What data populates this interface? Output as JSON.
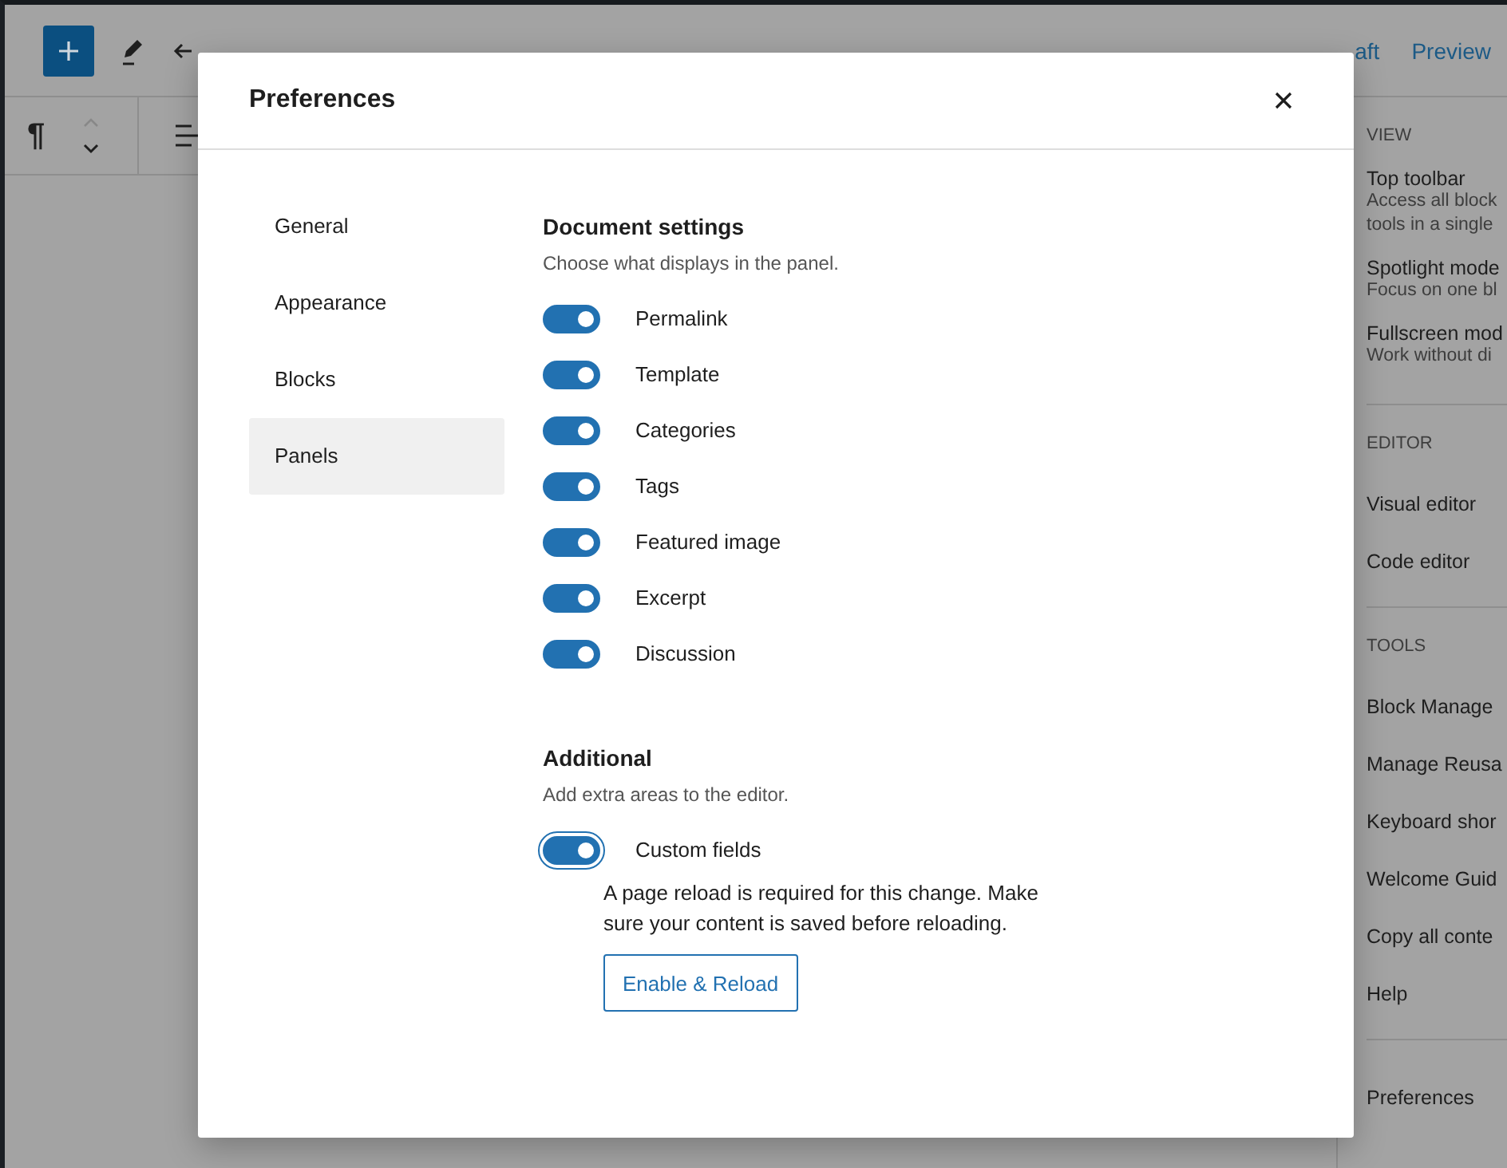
{
  "top_bar": {
    "save_draft": "aft",
    "preview": "Preview"
  },
  "block_toolbar": {
    "paragraph": "¶"
  },
  "sidebar": {
    "sections": [
      {
        "heading": "VIEW",
        "items": [
          {
            "label": "Top toolbar",
            "description": [
              "Access all block",
              "tools in a single"
            ]
          },
          {
            "label": "Spotlight mode",
            "description": [
              "Focus on one bl"
            ]
          },
          {
            "label": "Fullscreen mod",
            "description": [
              "Work without di"
            ]
          }
        ]
      },
      {
        "heading": "EDITOR",
        "items": [
          {
            "label": "Visual editor"
          },
          {
            "label": "Code editor"
          }
        ]
      },
      {
        "heading": "TOOLS",
        "items": [
          {
            "label": "Block Manage"
          },
          {
            "label": "Manage Reusa"
          },
          {
            "label": "Keyboard shor"
          },
          {
            "label": "Welcome Guid"
          },
          {
            "label": "Copy all conte"
          },
          {
            "label": "Help"
          }
        ]
      },
      {
        "items": [
          {
            "label": "Preferences"
          }
        ]
      }
    ]
  },
  "dialog": {
    "title": "Preferences",
    "nav": [
      {
        "label": "General",
        "selected": false
      },
      {
        "label": "Appearance",
        "selected": false
      },
      {
        "label": "Blocks",
        "selected": false
      },
      {
        "label": "Panels",
        "selected": true
      }
    ],
    "sections": [
      {
        "title": "Document settings",
        "description": "Choose what displays in the panel.",
        "toggles": [
          {
            "label": "Permalink",
            "on": true,
            "focused": false
          },
          {
            "label": "Template",
            "on": true,
            "focused": false
          },
          {
            "label": "Categories",
            "on": true,
            "focused": false
          },
          {
            "label": "Tags",
            "on": true,
            "focused": false
          },
          {
            "label": "Featured image",
            "on": true,
            "focused": false
          },
          {
            "label": "Excerpt",
            "on": true,
            "focused": false
          },
          {
            "label": "Discussion",
            "on": true,
            "focused": false
          }
        ]
      },
      {
        "title": "Additional",
        "description": "Add extra areas to the editor.",
        "toggles": [
          {
            "label": "Custom fields",
            "on": true,
            "focused": true,
            "note": "A page reload is required for this change. Make sure your content is saved before reloading.",
            "button": "Enable & Reload"
          }
        ]
      }
    ]
  }
}
